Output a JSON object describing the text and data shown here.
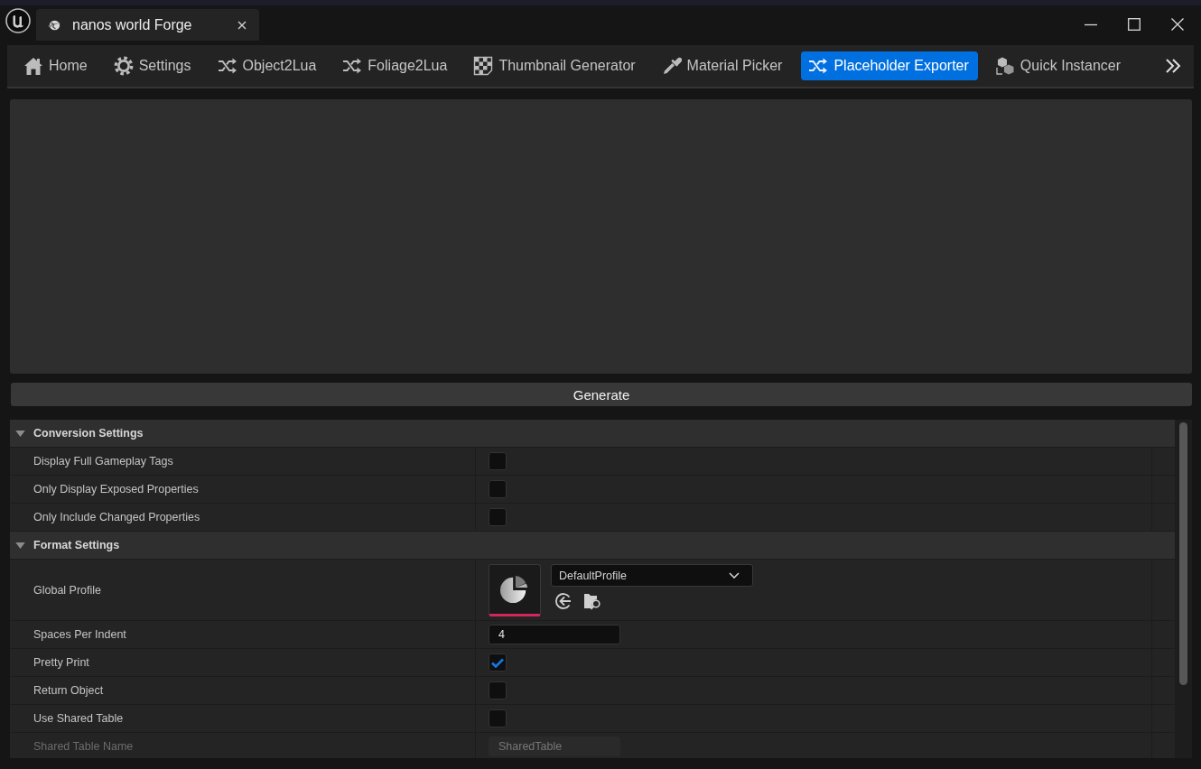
{
  "window": {
    "tab_title": "nanos world Forge"
  },
  "toolbar": {
    "items": [
      {
        "label": "Home",
        "selected": false
      },
      {
        "label": "Settings",
        "selected": false
      },
      {
        "label": "Object2Lua",
        "selected": false
      },
      {
        "label": "Foliage2Lua",
        "selected": false
      },
      {
        "label": "Thumbnail Generator",
        "selected": false
      },
      {
        "label": "Material Picker",
        "selected": false
      },
      {
        "label": "Placeholder Exporter",
        "selected": true
      },
      {
        "label": "Quick Instancer",
        "selected": false
      }
    ]
  },
  "generate_button": {
    "label": "Generate"
  },
  "details": {
    "categories": [
      {
        "label": "Conversion Settings",
        "expanded": true,
        "properties": [
          {
            "label": "Display Full Gameplay Tags",
            "kind": "checkbox",
            "checked": false,
            "disabled": false
          },
          {
            "label": "Only Display Exposed Properties",
            "kind": "checkbox",
            "checked": false,
            "disabled": false
          },
          {
            "label": "Only Include Changed Properties",
            "kind": "checkbox",
            "checked": false,
            "disabled": false
          }
        ]
      },
      {
        "label": "Format Settings",
        "expanded": true,
        "properties": [
          {
            "label": "Global Profile",
            "kind": "asset",
            "value": "DefaultProfile",
            "disabled": false
          },
          {
            "label": "Spaces Per Indent",
            "kind": "number",
            "value": "4",
            "disabled": false
          },
          {
            "label": "Pretty Print",
            "kind": "checkbox",
            "checked": true,
            "disabled": false
          },
          {
            "label": "Return Object",
            "kind": "checkbox",
            "checked": false,
            "disabled": false
          },
          {
            "label": "Use Shared Table",
            "kind": "checkbox",
            "checked": false,
            "disabled": false
          },
          {
            "label": "Shared Table Name",
            "kind": "text",
            "value": "SharedTable",
            "disabled": true
          }
        ]
      }
    ]
  }
}
